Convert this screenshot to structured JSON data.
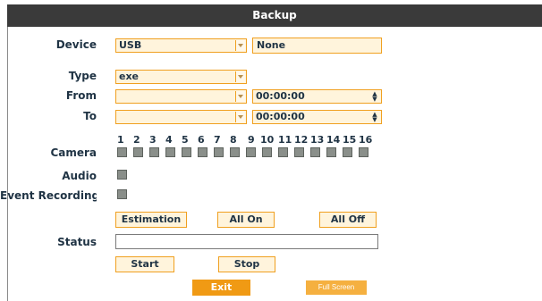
{
  "title": "Backup",
  "labels": {
    "device": "Device",
    "type": "Type",
    "from": "From",
    "to": "To",
    "camera": "Camera",
    "audio": "Audio",
    "event_recording": "Event Recording",
    "status": "Status"
  },
  "device": {
    "selected": "USB",
    "target": "None"
  },
  "type": {
    "selected": "exe"
  },
  "from": {
    "date": "",
    "time": "00:00:00"
  },
  "to": {
    "date": "",
    "time": "00:00:00"
  },
  "cameras": [
    "1",
    "2",
    "3",
    "4",
    "5",
    "6",
    "7",
    "8",
    "9",
    "10",
    "11",
    "12",
    "13",
    "14",
    "15",
    "16"
  ],
  "buttons": {
    "estimation": "Estimation",
    "all_on": "All On",
    "all_off": "All Off",
    "start": "Start",
    "stop": "Stop",
    "exit": "Exit",
    "full_screen": "Full Screen"
  },
  "status_value": "",
  "colors": {
    "accent": "#f0a020",
    "field_bg": "#fff4dc",
    "titlebar": "#3a3a3a",
    "exit": "#f09a14"
  }
}
